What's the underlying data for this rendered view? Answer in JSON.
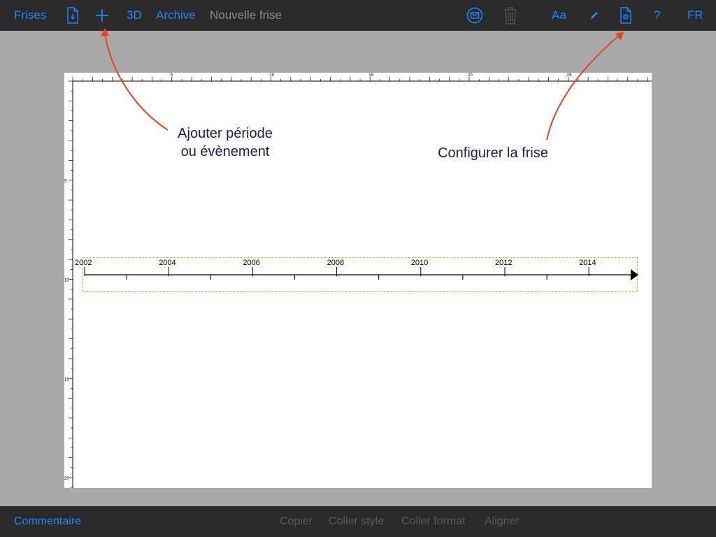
{
  "toolbar": {
    "frises_label": "Frises",
    "plus_label": "+",
    "three_d_label": "3D",
    "archive_label": "Archive",
    "title": "Nouvelle frise",
    "font_label": "Aa",
    "help_label": "?",
    "lang_label": "FR",
    "icons": {
      "new_doc": "new-document-icon",
      "add": "add-icon",
      "mail": "mail-icon",
      "trash": "trash-icon",
      "pencil": "pencil-icon",
      "settings": "settings-icon"
    }
  },
  "canvas": {
    "ruler_top_labels": [
      "5",
      "10",
      "15",
      "20",
      "25"
    ],
    "ruler_left_labels": [
      "5",
      "10",
      "15",
      "20"
    ],
    "annotation_add": [
      "Ajouter période",
      "ou évènement"
    ],
    "annotation_config": "Configurer la frise",
    "timeline": {
      "years": [
        "2002",
        "2004",
        "2006",
        "2008",
        "2010",
        "2012",
        "2014"
      ]
    }
  },
  "bottombar": {
    "commentaire": "Commentaire",
    "copier": "Copier",
    "coller_style": "Coller style",
    "coller_format": "Coller format",
    "aligner": "Aligner"
  },
  "colors": {
    "accent": "#1e88ff",
    "bar": "#2a2a2a",
    "background": "#a9a9a9",
    "arrow": "#e8441a",
    "annotation": "#1c1c5a",
    "selection": "#e8a040"
  }
}
